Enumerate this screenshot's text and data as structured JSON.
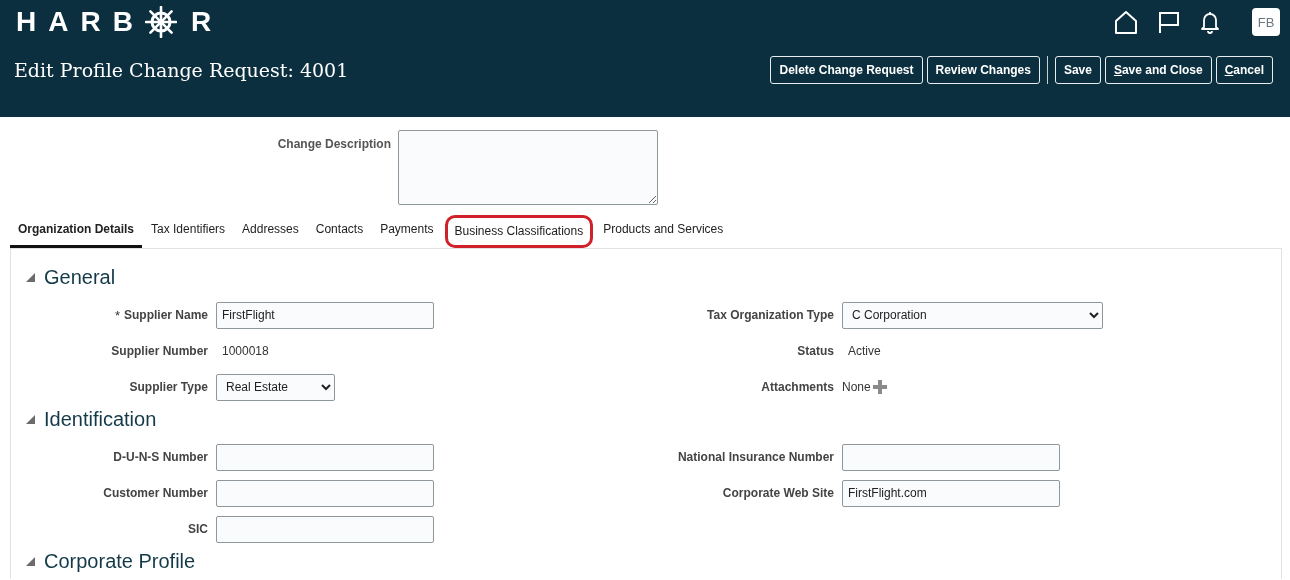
{
  "brand": {
    "before_mark": "HARB",
    "after_mark": "R"
  },
  "user": {
    "initials": "FB"
  },
  "page_title": "Edit Profile Change Request: 4001",
  "action_groups": [
    [
      {
        "label": "Delete Change Request",
        "underline_first": false
      },
      {
        "label": "Review Changes",
        "underline_first": false
      }
    ],
    [
      {
        "label": "Save",
        "underline_first": false
      },
      {
        "label": "Save and Close",
        "underline_first": true
      },
      {
        "label": "Cancel",
        "underline_first": true
      }
    ]
  ],
  "change_description": {
    "label": "Change Description"
  },
  "tabs": [
    {
      "label": "Organization Details",
      "selected": true,
      "circled": false
    },
    {
      "label": "Tax Identifiers",
      "selected": false,
      "circled": false
    },
    {
      "label": "Addresses",
      "selected": false,
      "circled": false
    },
    {
      "label": "Contacts",
      "selected": false,
      "circled": false
    },
    {
      "label": "Payments",
      "selected": false,
      "circled": false
    },
    {
      "label": "Business Classifications",
      "selected": false,
      "circled": true
    },
    {
      "label": "Products and Services",
      "selected": false,
      "circled": false
    }
  ],
  "sections": [
    {
      "title": "General",
      "expanded": true,
      "left": [
        {
          "label": "Supplier Name",
          "kind": "text",
          "value": "FirstFlight",
          "required_mark": "*"
        },
        {
          "label": "Supplier Number",
          "kind": "readonly",
          "value": "1000018"
        },
        {
          "label": "Supplier Type",
          "kind": "select",
          "value": "Real Estate"
        }
      ],
      "right": [
        {
          "label": "Tax Organization Type",
          "kind": "select",
          "value": "C Corporation"
        },
        {
          "label": "Status",
          "kind": "readonly",
          "value": "Active"
        },
        {
          "label": "Attachments",
          "kind": "attachments",
          "value": "None"
        }
      ]
    },
    {
      "title": "Identification",
      "expanded": true,
      "left": [
        {
          "label": "D-U-N-S Number",
          "kind": "text"
        },
        {
          "label": "Customer Number",
          "kind": "text"
        },
        {
          "label": "SIC",
          "kind": "text"
        }
      ],
      "right": [
        {
          "label": "National Insurance Number",
          "kind": "text"
        },
        {
          "label": "Corporate Web Site",
          "kind": "text",
          "value": "FirstFlight.com"
        }
      ]
    },
    {
      "title": "Corporate Profile",
      "expanded": true
    }
  ]
}
